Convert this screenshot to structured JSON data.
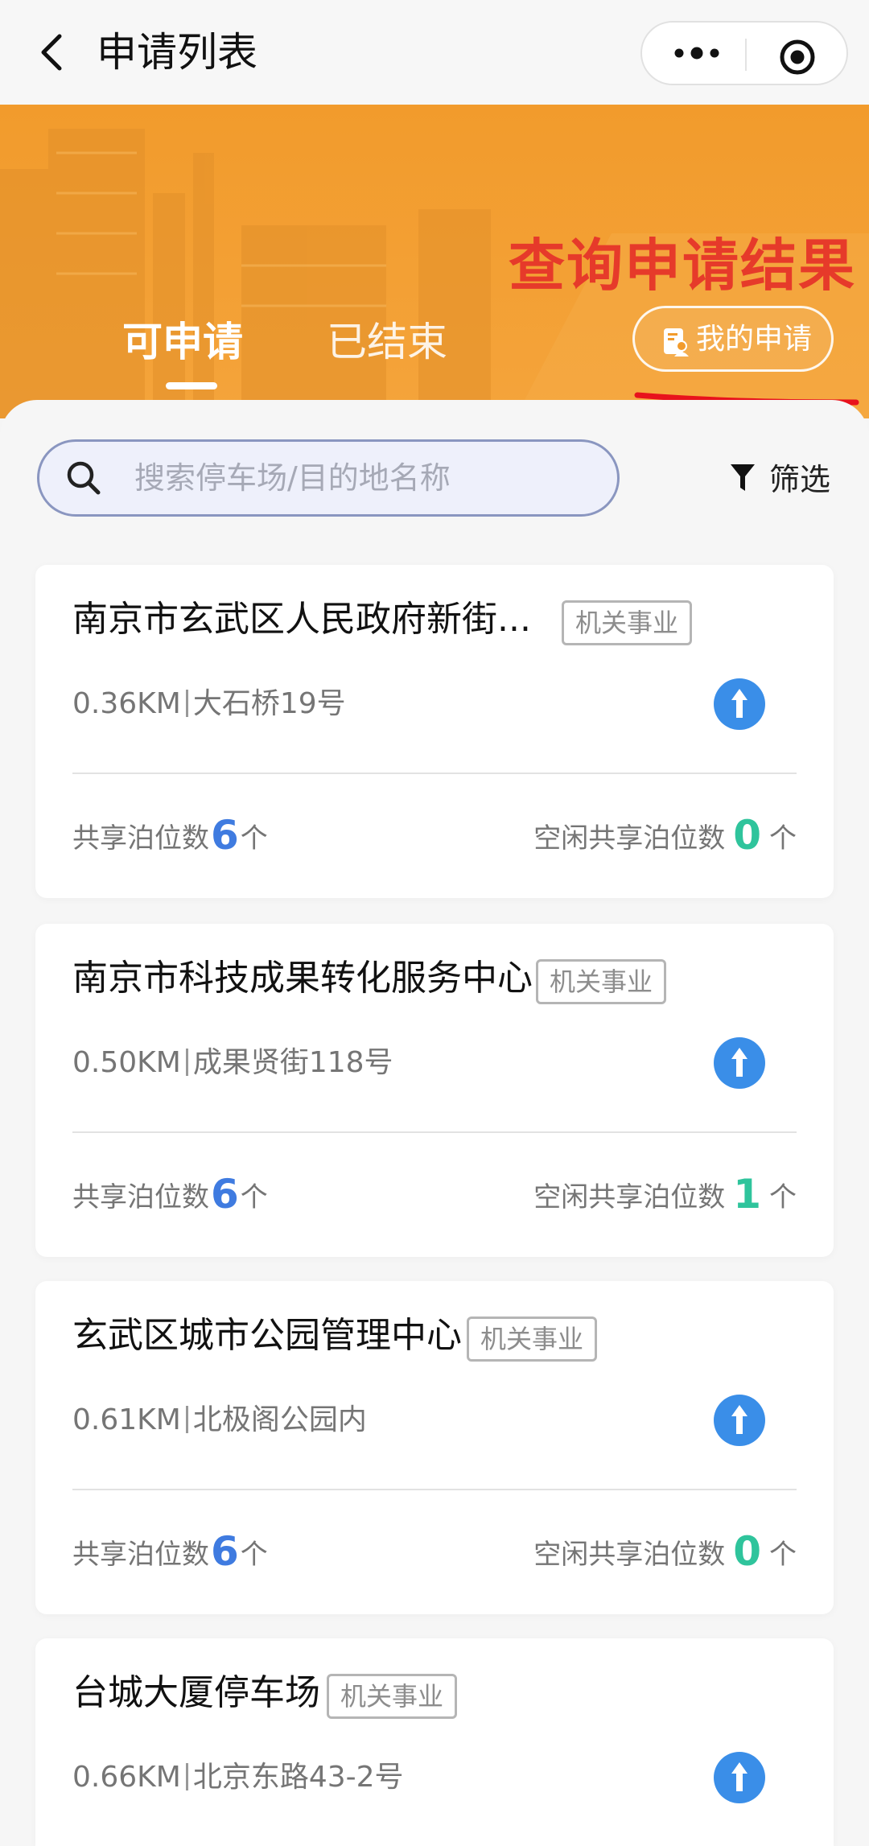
{
  "navbar": {
    "title": "申请列表"
  },
  "banner": {
    "caption": "查询申请结果",
    "tabs": [
      {
        "label": "可申请",
        "active": true
      },
      {
        "label": "已结束",
        "active": false
      }
    ],
    "my_application_label": "我的申请"
  },
  "search": {
    "placeholder": "搜索停车场/目的地名称",
    "value": ""
  },
  "filter": {
    "label": "筛选"
  },
  "colors": {
    "brand_orange": "#f29b2c",
    "accent_blue": "#3f7be0",
    "accent_green": "#2fc49c",
    "annotation_red": "#e63a2a"
  },
  "cards": [
    {
      "name": "南京市玄武区人民政府新街...",
      "tag": "机关事业",
      "distance": "0.36KM",
      "address": "大石桥19号",
      "shared_label": "共享泊位数",
      "shared_count": "6",
      "shared_unit": "个",
      "free_label": "空闲共享泊位数",
      "free_count": "0",
      "free_unit": "个"
    },
    {
      "name": "南京市科技成果转化服务中心",
      "tag": "机关事业",
      "distance": "0.50KM",
      "address": "成果贤街118号",
      "shared_label": "共享泊位数",
      "shared_count": "6",
      "shared_unit": "个",
      "free_label": "空闲共享泊位数",
      "free_count": "1",
      "free_unit": "个"
    },
    {
      "name": "玄武区城市公园管理中心",
      "tag": "机关事业",
      "distance": "0.61KM",
      "address": "北极阁公园内",
      "shared_label": "共享泊位数",
      "shared_count": "6",
      "shared_unit": "个",
      "free_label": "空闲共享泊位数",
      "free_count": "0",
      "free_unit": "个"
    },
    {
      "name": "台城大厦停车场",
      "tag": "机关事业",
      "distance": "0.66KM",
      "address": "北京东路43-2号"
    }
  ]
}
